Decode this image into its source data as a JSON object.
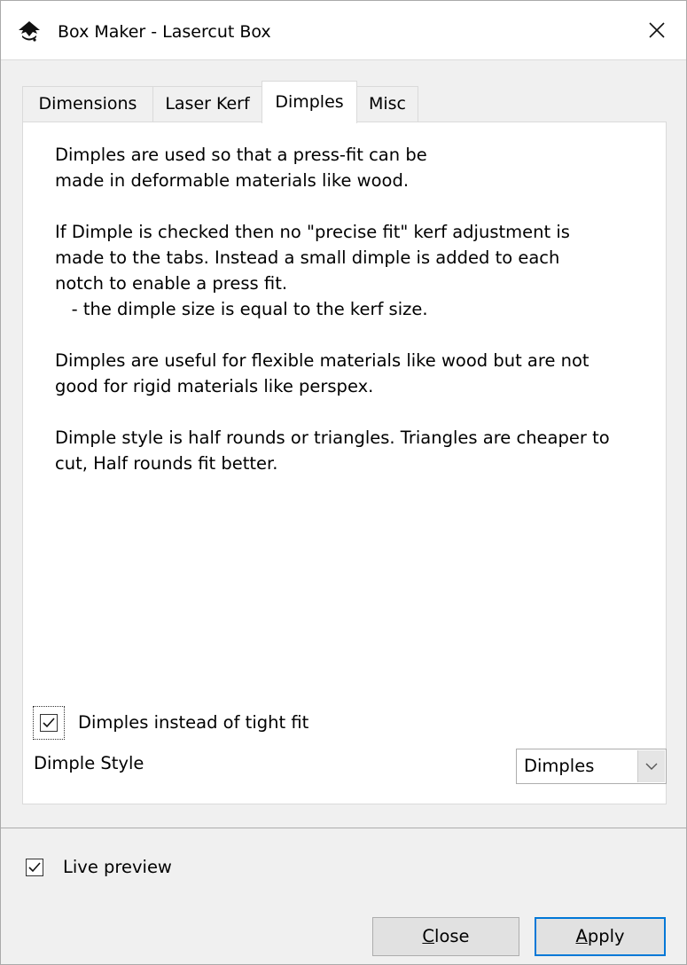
{
  "window": {
    "title": "Box Maker - Lasercut Box",
    "icon": "inkscape-icon",
    "close_icon": "close-icon"
  },
  "tabs": [
    {
      "label": "Dimensions",
      "active": false
    },
    {
      "label": "Laser Kerf",
      "active": false
    },
    {
      "label": "Dimples",
      "active": true
    },
    {
      "label": "Misc",
      "active": false
    }
  ],
  "dimples_tab": {
    "description": [
      "Dimples are used so that a press-fit can be\nmade in deformable materials like wood.",
      "If Dimple is checked then no \"precise fit\" kerf adjustment is\nmade to the tabs. Instead a small dimple is added to each\nnotch to enable a press fit.\n   - the dimple size is equal to the kerf size.",
      "Dimples are useful for flexible materials like wood but are not\ngood for rigid materials like perspex.",
      "Dimple style is half rounds or triangles. Triangles are cheaper to\ncut, Half rounds fit better."
    ],
    "dimple_checkbox": {
      "label": "Dimples instead of tight fit",
      "checked": true
    },
    "dimple_style": {
      "label": "Dimple Style",
      "selected": "Dimples"
    }
  },
  "footer": {
    "live_preview": {
      "label": "Live preview",
      "checked": true
    },
    "close_button": {
      "mnemonic": "C",
      "rest": "lose"
    },
    "apply_button": {
      "mnemonic": "A",
      "rest": "pply"
    }
  }
}
